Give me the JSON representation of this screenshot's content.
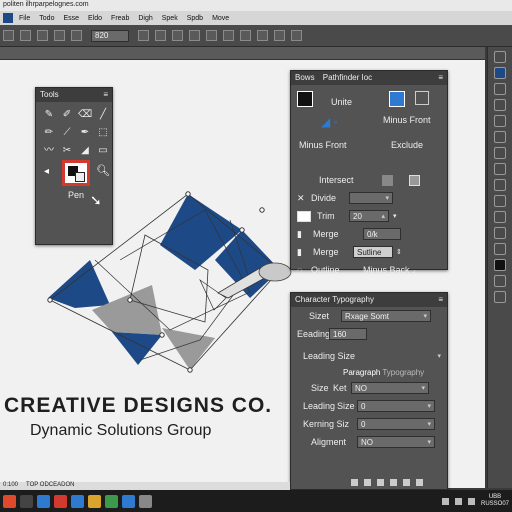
{
  "window": {
    "title": "politen ilhrparpelognes.com"
  },
  "menu": [
    "File",
    "Todo",
    "Esse",
    "Eldo",
    "Freab",
    "Digh",
    "Spek",
    "Spdb",
    "Move"
  ],
  "options": {
    "field_value": "820"
  },
  "canvas": {
    "company": "CREATIVE DESIGNS CO.",
    "tagline": "Dynamic Solutions Group",
    "colors": {
      "navy": "#1d4a86",
      "gray": "#9a9a9a",
      "paper": "#f1f1f1"
    }
  },
  "tools_panel": {
    "title": "Tools",
    "active_tool_label": "Pen",
    "active_color": "#d23a2f"
  },
  "pathfinder_panel": {
    "tabs": [
      "Bows",
      "Pathfinder Ioc"
    ],
    "unite": "Unite",
    "minus_front_right": "Minus Front",
    "minus_front": "Minus Front",
    "exclude": "Exclude",
    "intersect": "Intersect",
    "divide": "Divide",
    "trim": "Trim",
    "trim_value": "20",
    "merge1": "Merge",
    "merge1_value": "0/k",
    "merge2": "Merge",
    "merge2_value": "Sutline",
    "outline": "Outline",
    "minus_back": "Minus Back"
  },
  "character_panel": {
    "title": "Character Typography",
    "sizet_label": "Sizet",
    "sizet_value": "Rxage Somt",
    "leading_label": "Eeading",
    "leading_value": "160",
    "leading_size": "Leading Size",
    "tab_paragraph": "Paragraph",
    "tab_typography": "Typography",
    "size_label": "Size",
    "ket_label": "Ket",
    "ket_value": "NO",
    "leading_size2": "Leading",
    "size2": "Size",
    "leading_size_value": "0",
    "kerning_label": "Kerning Siz",
    "kerning_value": "0",
    "aligment_label": "Aligment",
    "aligment_value": "NO"
  },
  "taskbar": {
    "label": "TOP ODCEADON",
    "status": "0:100",
    "time": "UBB",
    "date": "RUSSO07"
  }
}
